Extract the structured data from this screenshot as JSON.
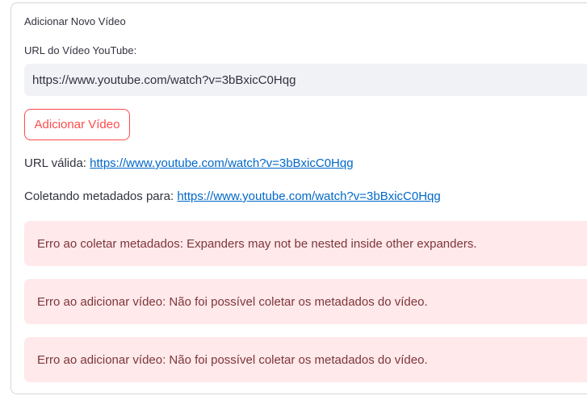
{
  "form": {
    "heading": "Adicionar Novo Vídeo",
    "url_label": "URL do Vídeo YouTube:",
    "url_value": "https://www.youtube.com/watch?v=3bBxicC0Hqg",
    "add_button_label": "Adicionar Vídeo"
  },
  "status": {
    "valid_prefix": "URL válida:",
    "valid_link": "https://www.youtube.com/watch?v=3bBxicC0Hqg",
    "collecting_prefix": "Coletando metadados para:",
    "collecting_link": "https://www.youtube.com/watch?v=3bBxicC0Hqg"
  },
  "errors": [
    "Erro ao coletar metadados: Expanders may not be nested inside other expanders.",
    "Erro ao adicionar vídeo: Não foi possível coletar os metadados do vídeo.",
    "Erro ao adicionar vídeo: Não foi possível coletar os metadados do vídeo."
  ],
  "colors": {
    "accent": "#ff4b4b",
    "link": "#0068c9",
    "error_bg": "#ffe9ea",
    "error_text": "#7d353b"
  }
}
